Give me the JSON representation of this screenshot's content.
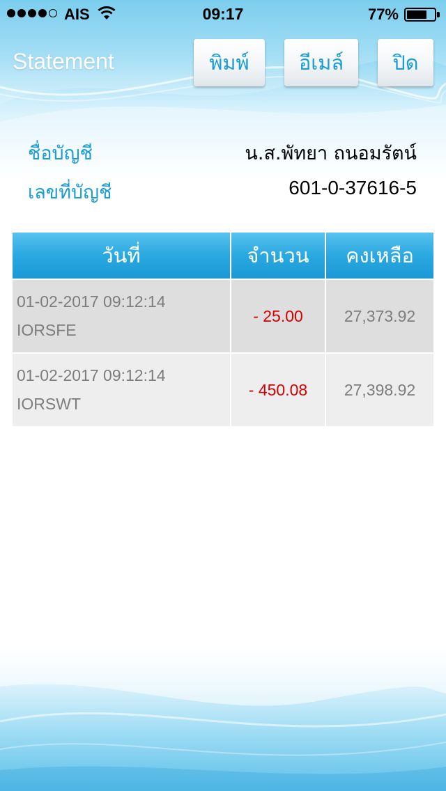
{
  "status_bar": {
    "carrier": "AIS",
    "time": "09:17",
    "battery_percent_text": "77%",
    "battery_level": 0.77,
    "signal_bars_filled": 4,
    "signal_bars_total": 5,
    "icons": [
      "signal-dots-icon",
      "wifi-icon",
      "battery-icon"
    ]
  },
  "header": {
    "title": "Statement",
    "buttons": {
      "print_label": "พิมพ์",
      "email_label": "อีเมล์",
      "close_label": "ปิด"
    }
  },
  "account": {
    "name_label": "ชื่อบัญชี",
    "name_value": "น.ส.พัทยา ถนอมรัตน์",
    "number_label": "เลขที่บัญชี",
    "number_value": "601-0-37616-5"
  },
  "table": {
    "headers": {
      "date": "วันที่",
      "amount": "จำนวน",
      "balance": "คงเหลือ"
    },
    "rows": [
      {
        "datetime": "01-02-2017 09:12:14",
        "code": "IORSFE",
        "amount": "- 25.00",
        "balance": "27,373.92"
      },
      {
        "datetime": "01-02-2017 09:12:14",
        "code": "IORSWT",
        "amount": "- 450.08",
        "balance": "27,398.92"
      }
    ]
  },
  "colors": {
    "accent_blue": "#1a9cd6",
    "header_blue": "#2aa8e0",
    "negative_red": "#d60000",
    "muted_gray": "#7d7d7d"
  }
}
